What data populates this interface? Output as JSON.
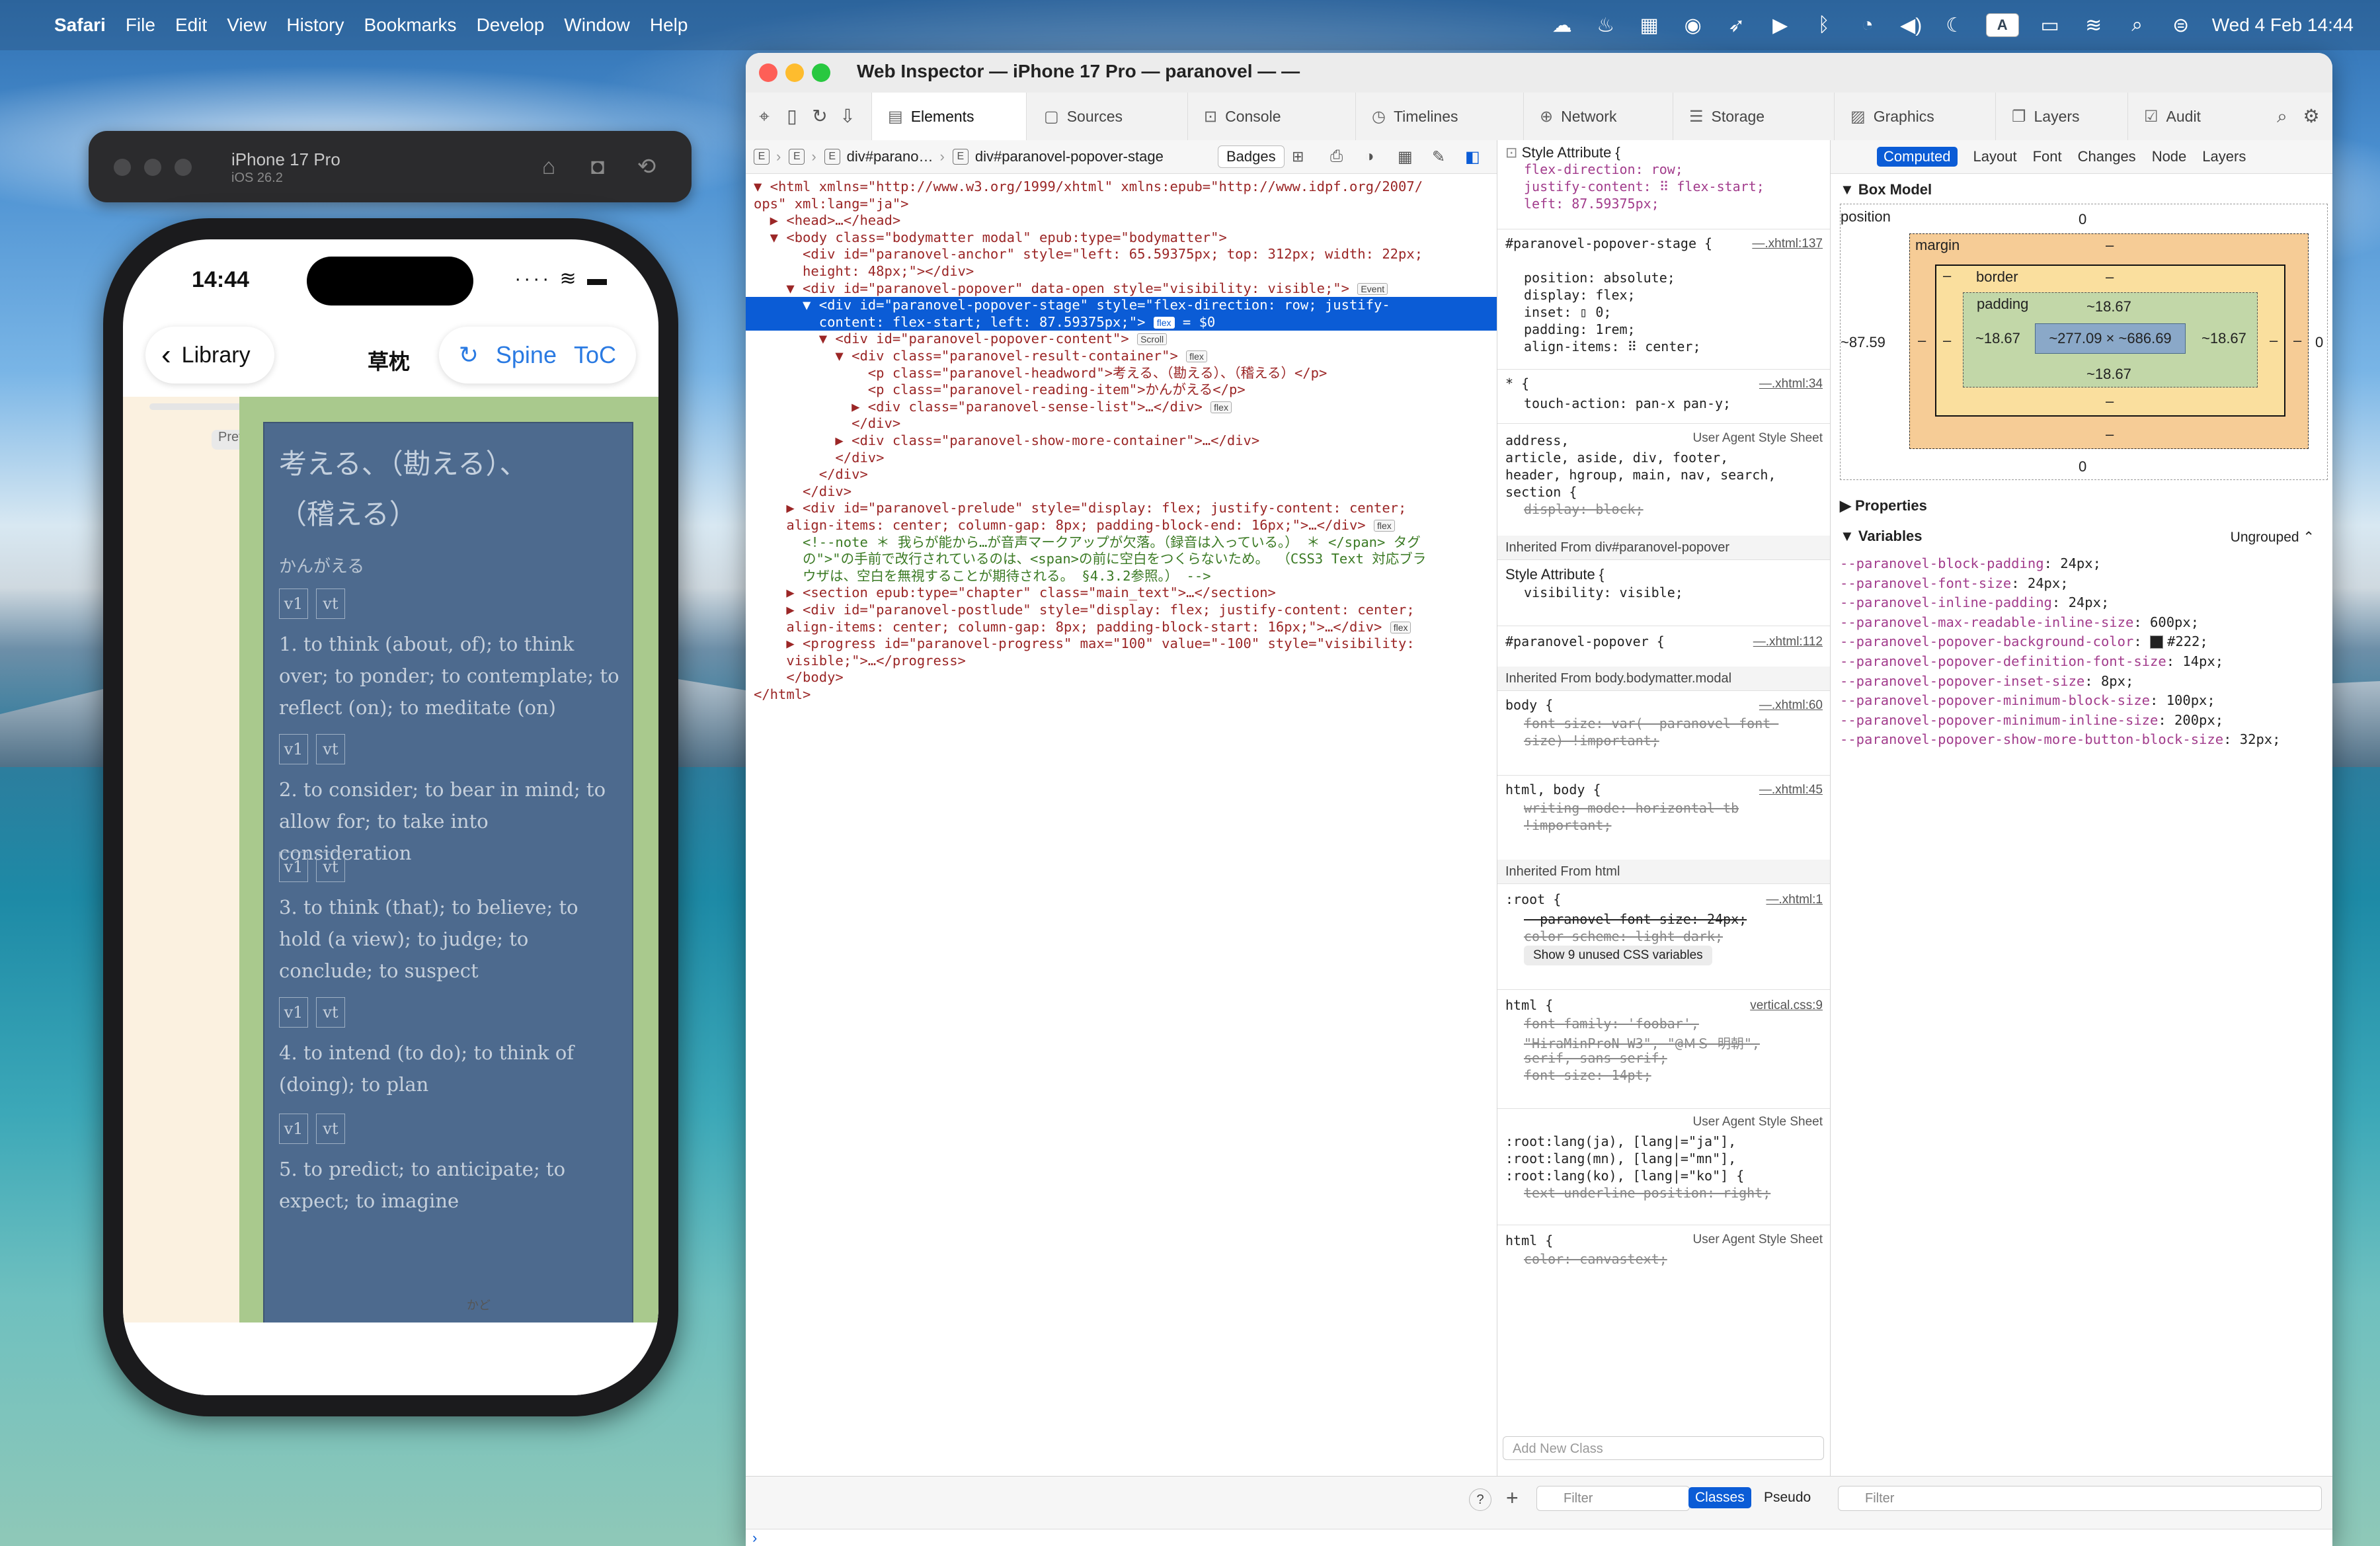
{
  "menubar": {
    "app": "Safari",
    "items": [
      "File",
      "Edit",
      "View",
      "History",
      "Bookmarks",
      "Develop",
      "Window",
      "Help"
    ],
    "clock": "Wed 4 Feb  14:44",
    "badge": "A"
  },
  "simulator": {
    "device": "iPhone 17 Pro",
    "os": "iOS 26.2"
  },
  "phone": {
    "time": "14:44",
    "status": "···· ≋ ▬",
    "back_label": "Library",
    "title": "草枕",
    "spine_label": "Spine",
    "toc_label": "ToC",
    "preview_label": "Previ",
    "headword_line1": "考える、（勘える）、",
    "headword_line2": "（稽える）",
    "reading": "かんがえる",
    "v1": "v1",
    "vt": "vt",
    "senses": [
      "1. to think (about, of); to think over; to ponder; to contemplate; to reflect (on); to meditate (on)",
      "2. to consider; to bear in mind; to allow for; to take into consideration",
      "3. to think (that); to believe; to hold (a view); to judge; to conclude; to suspect",
      "4. to intend (to do); to think of (doing); to plan",
      "5. to predict; to anticipate; to expect; to imagine"
    ],
    "bottom_text": "かど"
  },
  "inspector": {
    "title": "Web Inspector — iPhone 17 Pro — paranovel — —",
    "tabs": [
      "Elements",
      "Sources",
      "Console",
      "Timelines",
      "Network",
      "Storage",
      "Graphics",
      "Layers",
      "Audit"
    ],
    "breadcrumb": [
      "div#parano…",
      "div#paranovel-popover-stage"
    ],
    "badges_label": "Badges",
    "dom": [
      "▼ <html xmlns=\"http://www.w3.org/1999/xhtml\" xmlns:epub=\"http://www.idpf.org/2007/",
      "ops\" xml:lang=\"ja\">",
      "  ▶ <head>…</head>",
      "  ▼ <body class=\"bodymatter modal\" epub:type=\"bodymatter\">",
      "      <div id=\"paranovel-anchor\" style=\"left: 65.59375px; top: 312px; width: 22px;",
      "      height: 48px;\"></div>",
      "    ▼ <div id=\"paranovel-popover\" data-open style=\"visibility: visible;\">",
      "      ▼ <div id=\"paranovel-popover-stage\" style=\"flex-direction: row; justify-",
      "        content: flex-start; left: 87.59375px;\">",
      "        ▼ <div id=\"paranovel-popover-content\">",
      "          ▼ <div class=\"paranovel-result-container\">",
      "              <p class=\"paranovel-headword\">考える、（勘える）、（稽える）</p>",
      "              <p class=\"paranovel-reading-item\">かんがえる</p>",
      "            ▶ <div class=\"paranovel-sense-list\">…</div>",
      "            </div>",
      "          ▶ <div class=\"paranovel-show-more-container\">…</div>",
      "          </div>",
      "        </div>",
      "      </div>",
      "    ▶ <div id=\"paranovel-prelude\" style=\"display: flex; justify-content: center;",
      "    align-items: center; column-gap: 8px; padding-block-end: 16px;\">…</div>",
      "      <!--note ＊ 我らが能から…が音声マークアップが欠落。（録音は入っている。） ＊ </span> タグ",
      "      の\">\"の手前で改行されているのは、<span>の前に空白をつくらないため。 （CSS3 Text 対応ブラ",
      "      ウザは、空白を無視することが期待される。 §4.3.2参照。） -->",
      "    ▶ <section epub:type=\"chapter\" class=\"main_text\">…</section>",
      "    ▶ <div id=\"paranovel-postlude\" style=\"display: flex; justify-content: center;",
      "    align-items: center; column-gap: 8px; padding-block-start: 16px;\">…</div>",
      "    ▶ <progress id=\"paranovel-progress\" max=\"100\" value=\"-100\" style=\"visibility:",
      "    visible;\">…</progress>",
      "    </body>",
      "</html>"
    ],
    "dom_badges": {
      "popover": "Event",
      "stage": "flex",
      "stage_sel": "= $0",
      "content": "Scroll",
      "result": "flex",
      "sense": "flex",
      "prelude": "flex",
      "postlude": "flex"
    },
    "styles": {
      "style_attr": "Style Attribute {",
      "sa_lines": [
        "flex-direction: row;",
        "justify-content: ⠿ flex-start;",
        "left: 87.59375px;"
      ],
      "r1_sel": "#paranovel-popover-stage {",
      "r1_src": "—.xhtml:137",
      "r1_lines": [
        "position: absolute;",
        "display: flex;",
        "inset: ▯ 0;",
        "padding: 1rem;",
        "align-items: ⠿ center;"
      ],
      "r2_sel": "* {",
      "r2_src": "—.xhtml:34",
      "r2_lines": [
        "touch-action: pan-x pan-y;"
      ],
      "ua_label": "User Agent Style Sheet",
      "r3_sel": [
        "address,",
        "article, aside, div, footer,",
        "header, hgroup, main, nav, search,",
        "section {"
      ],
      "r3_lines": [
        "display: block;"
      ],
      "inh1": "Inherited From div#paranovel-popover",
      "sa2_lines": [
        "visibility: visible;"
      ],
      "r4_sel": "#paranovel-popover {",
      "r4_src": "—.xhtml:112",
      "inh2": "Inherited From body.bodymatter.modal",
      "r5_sel": "body {",
      "r5_src": "—.xhtml:60",
      "r5_lines": [
        "font-size: var(--paranovel-font-",
        "size) !important;"
      ],
      "r6_sel": "html, body {",
      "r6_src": "—.xhtml:45",
      "r6_lines": [
        "writing-mode: horizontal-tb",
        "!important;"
      ],
      "inh3": "Inherited From html",
      "r7_sel": ":root {",
      "r7_src": "—.xhtml:1",
      "r7_lines": [
        "--paranovel-font-size: 24px;",
        "color-scheme: light dark;"
      ],
      "r7_btn": "Show 9 unused CSS variables",
      "r8_sel": "html {",
      "r8_src": "vertical.css:9",
      "r8_lines": [
        "font-family: 'foobar',",
        "\"HiraMinProN-W3\", \"@ＭＳ 明朝\",",
        "serif, sans-serif;",
        "font-size: 14pt;"
      ],
      "r9_sel": [
        ":root:lang(ja), [lang|=\"ja\"],",
        ":root:lang(mn), [lang|=\"mn\"],",
        ":root:lang(ko), [lang|=\"ko\"] {"
      ],
      "r9_lines": [
        "text-underline-position: right;"
      ],
      "r10_sel": "html {",
      "r10_lines": [
        "color: canvastext;"
      ],
      "add_class": "Add New Class",
      "filter": "Filter",
      "classes_btn": "Classes",
      "pseudo_btn": "Pseudo"
    },
    "computed": {
      "tabs": [
        "Computed",
        "Layout",
        "Font",
        "Changes",
        "Node",
        "Layers"
      ],
      "box_model_label": "Box Model",
      "position_label": "position",
      "margin_label": "margin",
      "border_label": "border",
      "padding_label": "padding",
      "pos_top": "0",
      "pos_bottom": "0",
      "pos_left": "~87.59",
      "pos_right": "0",
      "margin_top": "–",
      "margin_bottom": "–",
      "margin_left": "–",
      "margin_right": "–",
      "border_top": "–",
      "border_bottom": "–",
      "border_left": "–",
      "border_right": "–",
      "pad_top": "~18.67",
      "pad_bottom": "~18.67",
      "pad_left": "~18.67",
      "pad_right": "~18.67",
      "content": "~277.09 × ~686.69",
      "properties_label": "Properties",
      "variables_label": "Variables",
      "ungrouped": "Ungrouped ⌃",
      "vars": [
        {
          "n": "--paranovel-block-padding",
          "v": "24px"
        },
        {
          "n": "--paranovel-font-size",
          "v": "24px"
        },
        {
          "n": "--paranovel-inline-padding",
          "v": "24px"
        },
        {
          "n": "--paranovel-max-readable-inline-size",
          "v": "600px"
        },
        {
          "n": "--paranovel-popover-background-color",
          "v": "#222"
        },
        {
          "n": "--paranovel-popover-definition-font-size",
          "v": "14px"
        },
        {
          "n": "--paranovel-popover-inset-size",
          "v": "8px"
        },
        {
          "n": "--paranovel-popover-minimum-block-size",
          "v": "100px"
        },
        {
          "n": "--paranovel-popover-minimum-inline-size",
          "v": "200px"
        },
        {
          "n": "--paranovel-popover-show-more-button-block-size",
          "v": "32px"
        }
      ],
      "filter": "Filter"
    }
  },
  "colors": {
    "accent": "#0b5cd6",
    "popover": "#4d6a8e",
    "green_overlay": "#a9c98d",
    "margin": "#f6cc96",
    "padding": "#c2d7a8"
  }
}
